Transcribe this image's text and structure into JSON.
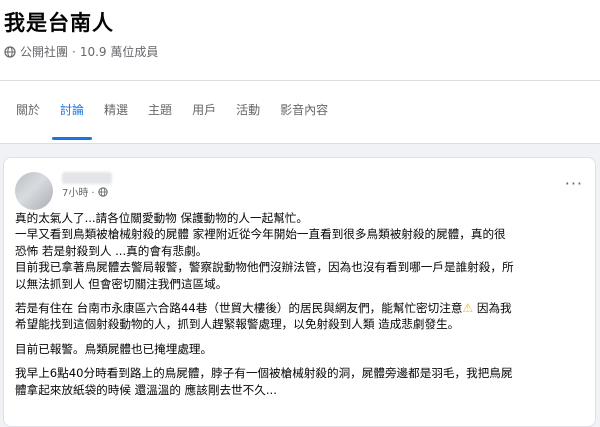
{
  "group": {
    "title": "我是台南人",
    "privacy": "公開社團",
    "separator": "·",
    "members": "10.9 萬位成員"
  },
  "tabs": [
    {
      "label": "關於"
    },
    {
      "label": "討論"
    },
    {
      "label": "精選"
    },
    {
      "label": "主題"
    },
    {
      "label": "用戶"
    },
    {
      "label": "活動"
    },
    {
      "label": "影音內容"
    }
  ],
  "active_tab": "討論",
  "post": {
    "time": "7小時",
    "more_label": "···",
    "paragraphs": [
      {
        "lines": [
          "真的太氣人了...請各位關愛動物 保護動物的人一起幫忙。",
          "一早又看到鳥類被槍械射殺的屍體 家裡附近從今年開始一直看到很多鳥類被射殺的屍體，真的很",
          "恐怖 若是射殺到人 ...真的會有悲劇。",
          "目前我已拿著鳥屍體去警局報警，警察說動物他們沒辦法管，因為也沒有看到哪一戶是誰射殺，所",
          "以無法抓到人 但會密切關注我們這區域。"
        ]
      },
      {
        "lines_before_icon": "若是有住在 台南市永康區六合路44巷（世貿大樓後）的居民與網友們，能幫忙密切注意",
        "icon": "warning-icon",
        "lines_after_icon": " 因為我",
        "lines": [
          "希望能找到這個射殺動物的人，抓到人趕緊報警處理，以免射殺到人類 造成悲劇發生。"
        ]
      },
      {
        "lines": [
          "目前已報警。鳥類屍體也已掩埋處理。"
        ]
      },
      {
        "lines": [
          "我早上6點40分時看到路上的鳥屍體，脖子有一個被槍械射殺的洞，屍體旁邊都是羽毛，我把鳥屍",
          "體拿起來放紙袋的時候 還溫溫的 應該剛去世不久..."
        ]
      }
    ]
  },
  "colors": {
    "accent": "#1b74e4",
    "muted": "#65676b",
    "text": "#050505",
    "page_bg": "#f0f2f5",
    "warning": "#f7b928"
  }
}
